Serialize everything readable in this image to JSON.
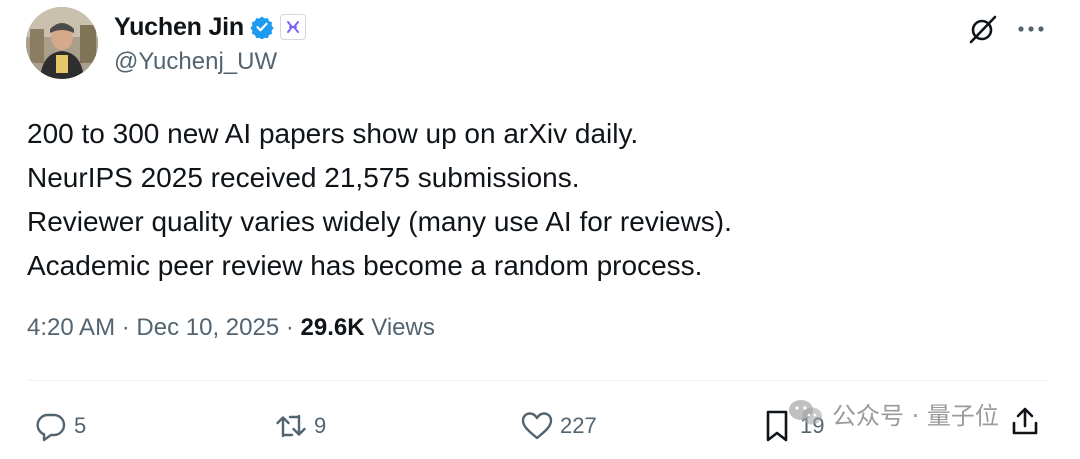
{
  "author": {
    "display_name": "Yuchen Jin",
    "handle": "@Yuchenj_UW",
    "verified": true
  },
  "tweet": {
    "lines": [
      "200 to 300 new AI papers show up on arXiv daily.",
      "NeurIPS 2025 received 21,575 submissions.",
      "Reviewer quality varies widely (many use AI for reviews).",
      "Academic peer review has become a random process."
    ],
    "time": "4:20 AM",
    "separator": "·",
    "date": "Dec 10, 2025",
    "views_count": "29.6K",
    "views_label": "Views"
  },
  "actions": {
    "replies": "5",
    "reposts": "9",
    "likes": "227",
    "bookmarks": "19"
  },
  "watermark": {
    "text": "公众号 · 量子位"
  },
  "colors": {
    "text": "#0f1419",
    "secondary": "#536471",
    "verified_blue": "#1d9bf0",
    "divider": "#eff3f4"
  },
  "icons": [
    "verified-badge-icon",
    "affiliate-badge-icon",
    "grok-icon",
    "more-icon",
    "reply-icon",
    "repost-icon",
    "like-icon",
    "bookmark-icon",
    "share-icon",
    "wechat-icon"
  ]
}
